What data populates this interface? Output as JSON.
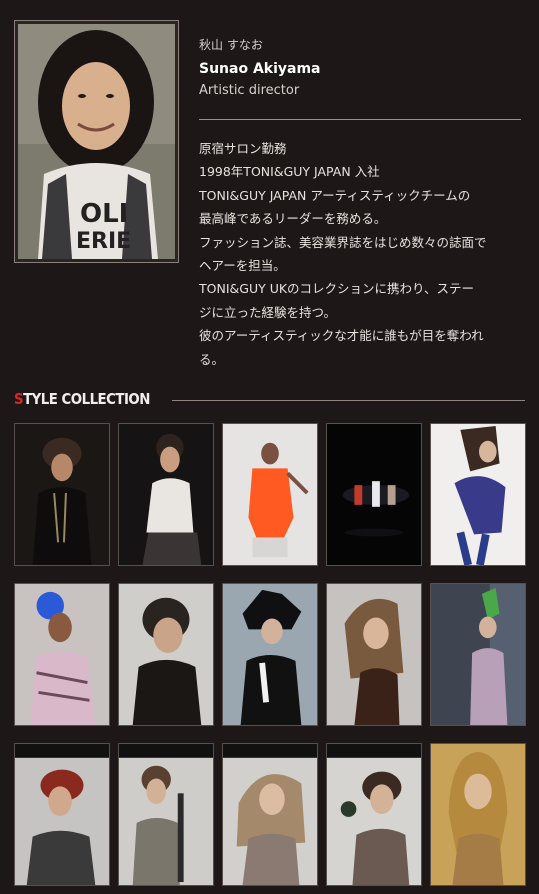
{
  "profile": {
    "name_jp": "秋山 すなお",
    "name_en": "Sunao Akiyama",
    "role": "Artistic director",
    "bio_lines": [
      "原宿サロン勤務",
      "1998年TONI&GUY JAPAN 入社",
      "TONI&GUY JAPAN アーティスティックチームの",
      "最高峰であるリーダーを務める。",
      "ファッション誌、美容業界誌をはじめ数々の誌面で",
      "ヘアーを担当。",
      "TONI&GUY UKのコレクションに携わり、ステー",
      "ジに立った経験を持つ。",
      "彼のアーティスティックな才能に誰もが目を奪われ",
      "る。"
    ]
  },
  "style_collection": {
    "title_accent": "S",
    "title_rest": "TYLE COLLECTION"
  },
  "colors": {
    "background": "#1d1817",
    "accent": "#d42a22",
    "divider": "#9a908a"
  }
}
